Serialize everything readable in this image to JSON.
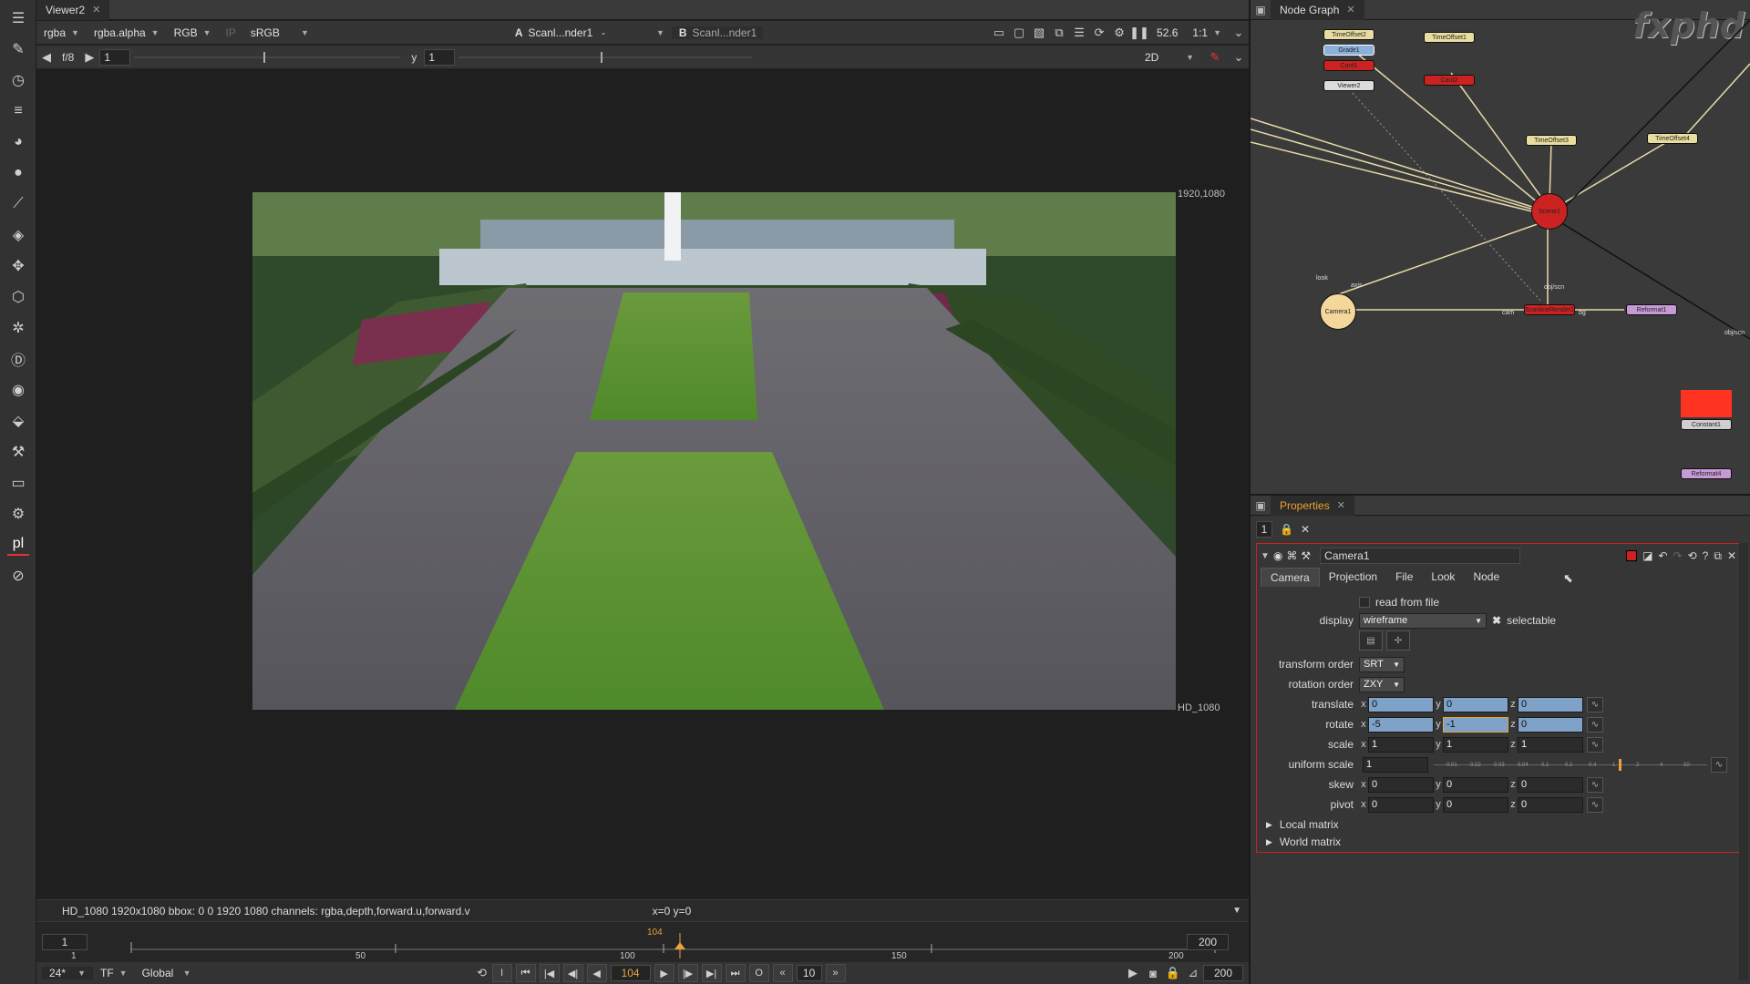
{
  "viewer": {
    "tab_title": "Viewer2",
    "channels": "rgba",
    "alpha_channel": "rgba.alpha",
    "color_mode": "RGB",
    "ip_label": "IP",
    "lut": "sRGB",
    "input_a_label": "A",
    "input_a": "Scanl...nder1",
    "compare_op": "-",
    "input_b_label": "B",
    "input_b": "Scanl...nder1",
    "zoom": "52.6",
    "ratio": "1:1",
    "fstop": "f/8",
    "gain": "1",
    "gamma_label": "y",
    "gamma": "1",
    "view_mode": "2D",
    "format_top": "1920,1080",
    "format_bottom": "HD_1080",
    "status_info": "HD_1080 1920x1080  bbox: 0 0 1920 1080 channels: rgba,depth,forward.u,forward.v",
    "coords": "x=0 y=0"
  },
  "timeline": {
    "start": "1",
    "end": "200",
    "current": "104",
    "ticks": [
      "1",
      "50",
      "100",
      "150",
      "200"
    ],
    "fps": "24*",
    "tf": "TF",
    "scope": "Global",
    "frame_field": "104",
    "step": "10",
    "end_field": "200",
    "start_field": "1",
    "end_field_top": "200"
  },
  "node_graph": {
    "tab_title": "Node Graph",
    "brand": "fxphd",
    "nodes": [
      {
        "label": "TimeOffset2"
      },
      {
        "label": "Grade1"
      },
      {
        "label": "Card1"
      },
      {
        "label": "Viewer2"
      },
      {
        "label": "TimeOffset1"
      },
      {
        "label": "Card2"
      },
      {
        "label": "TimeOffset3"
      },
      {
        "label": "TimeOffset4"
      },
      {
        "label": "Scene1"
      },
      {
        "label": "Camera1"
      },
      {
        "label": "ScanlineRender1"
      },
      {
        "label": "Reformat1"
      },
      {
        "label": "Constant1"
      },
      {
        "label": "Reformat4"
      }
    ],
    "pipe_labels": [
      "obj/scn",
      "cam",
      "bg",
      "look",
      "axis",
      "obj/scn"
    ]
  },
  "properties": {
    "tab_title": "Properties",
    "max_panels": "1",
    "node_name": "Camera1",
    "tabs": [
      "Camera",
      "Projection",
      "File",
      "Look",
      "Node"
    ],
    "read_from_file": "read from file",
    "display_label": "display",
    "display_value": "wireframe",
    "selectable_label": "selectable",
    "transform_order_label": "transform order",
    "transform_order": "SRT",
    "rotation_order_label": "rotation order",
    "rotation_order": "ZXY",
    "translate_label": "translate",
    "translate": {
      "x": "0",
      "y": "0",
      "z": "0"
    },
    "rotate_label": "rotate",
    "rotate": {
      "x": "-5",
      "y": "-1",
      "z": "0"
    },
    "scale_label": "scale",
    "scale": {
      "x": "1",
      "y": "1",
      "z": "1"
    },
    "uniform_scale_label": "uniform scale",
    "uniform_scale": "1",
    "skew_label": "skew",
    "skew": {
      "x": "0",
      "y": "0",
      "z": "0"
    },
    "pivot_label": "pivot",
    "pivot": {
      "x": "0",
      "y": "0",
      "z": "0"
    },
    "local_matrix": "Local matrix",
    "world_matrix": "World matrix",
    "slider_ticks": [
      "0.01",
      "0.02",
      "0.03",
      "0.04",
      "0.1",
      "0.2",
      "0.4",
      "1",
      "2",
      "4",
      "10"
    ]
  },
  "colors": {
    "accent_orange": "#e8a33a",
    "selection_red": "#cc2222",
    "field_blue": "#7ea2c8"
  }
}
